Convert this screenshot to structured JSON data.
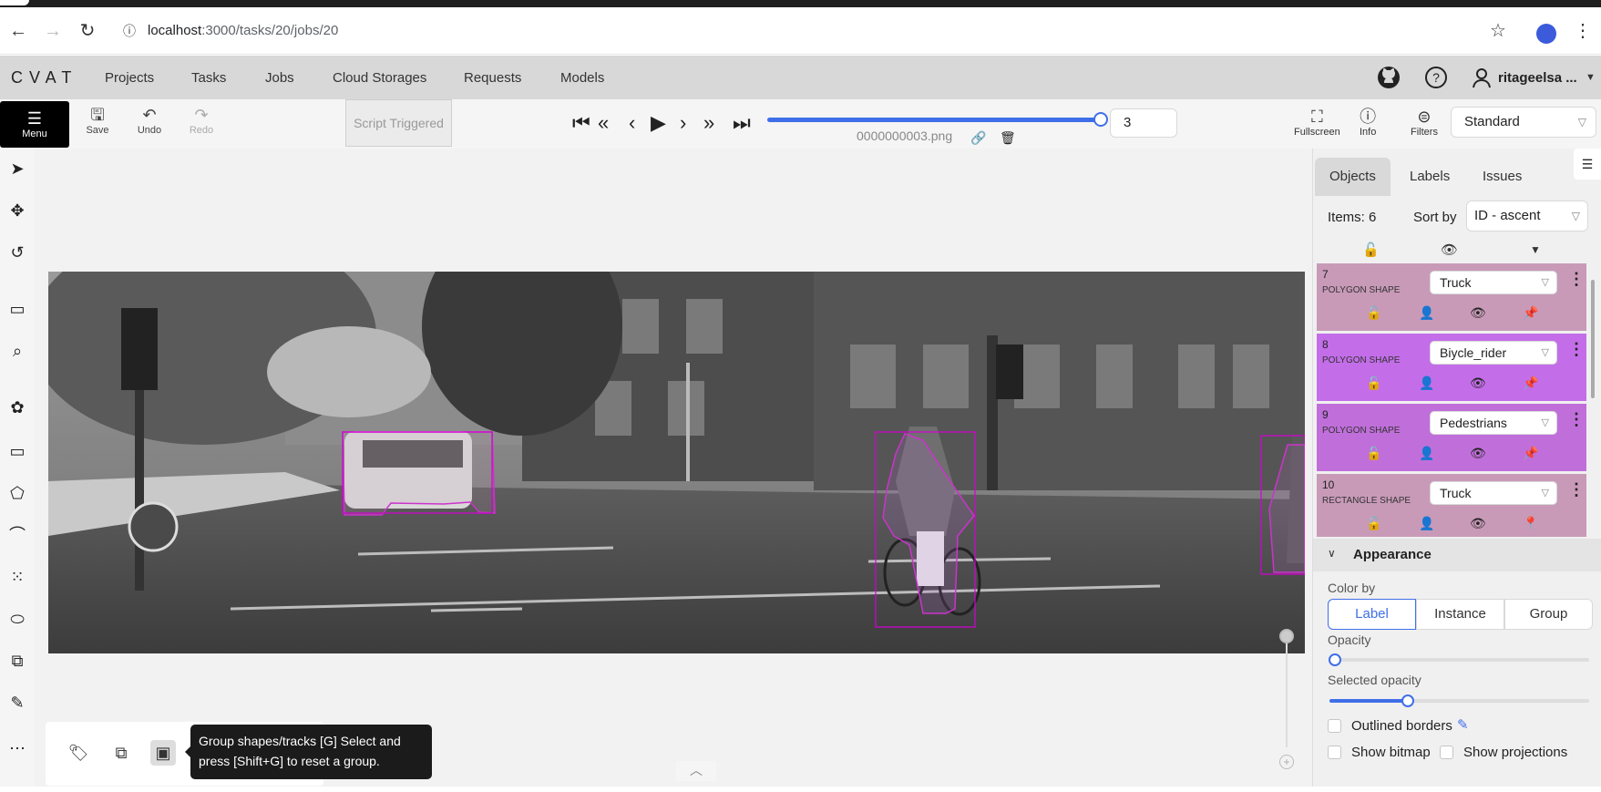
{
  "browser": {
    "url_host": "localhost",
    "url_path": ":3000/tasks/20/jobs/20"
  },
  "header": {
    "logo": "CVAT",
    "nav": [
      "Projects",
      "Tasks",
      "Jobs",
      "Cloud Storages",
      "Requests",
      "Models"
    ],
    "username": "ritageelsa ..."
  },
  "toolbar": {
    "menu_label": "Menu",
    "save_label": "Save",
    "undo_label": "Undo",
    "redo_label": "Redo",
    "script_label": "Script Triggered",
    "frame_number": "3",
    "filename": "0000000003.png",
    "fullscreen_label": "Fullscreen",
    "info_label": "Info",
    "filters_label": "Filters",
    "workspace": "Standard",
    "frame_progress": 0.99
  },
  "sidebar": {
    "tabs": [
      "Objects",
      "Labels",
      "Issues"
    ],
    "items_count": "Items: 6",
    "sort_label": "Sort by",
    "sort_value": "ID - ascent",
    "objects": [
      {
        "id": "7",
        "type": "POLYGON SHAPE",
        "label": "Truck",
        "color": "#c89ab8"
      },
      {
        "id": "8",
        "type": "POLYGON SHAPE",
        "label": "Biycle_rider",
        "color": "#c36ee8"
      },
      {
        "id": "9",
        "type": "POLYGON SHAPE",
        "label": "Pedestrians",
        "color": "#c06fda"
      },
      {
        "id": "10",
        "type": "RECTANGLE SHAPE",
        "label": "Truck",
        "color": "#c89ab8"
      }
    ],
    "appearance": {
      "title": "Appearance",
      "color_by_label": "Color by",
      "color_by_options": [
        "Label",
        "Instance",
        "Group"
      ],
      "opacity_label": "Opacity",
      "opacity_value": 0.0,
      "selected_opacity_label": "Selected opacity",
      "selected_opacity_value": 0.3,
      "outlined_borders_label": "Outlined borders",
      "show_bitmap_label": "Show bitmap",
      "show_projections_label": "Show projections"
    }
  },
  "canvas": {
    "tooltip": "Group shapes/tracks [G] Select and press [Shift+G] to reset a group."
  }
}
